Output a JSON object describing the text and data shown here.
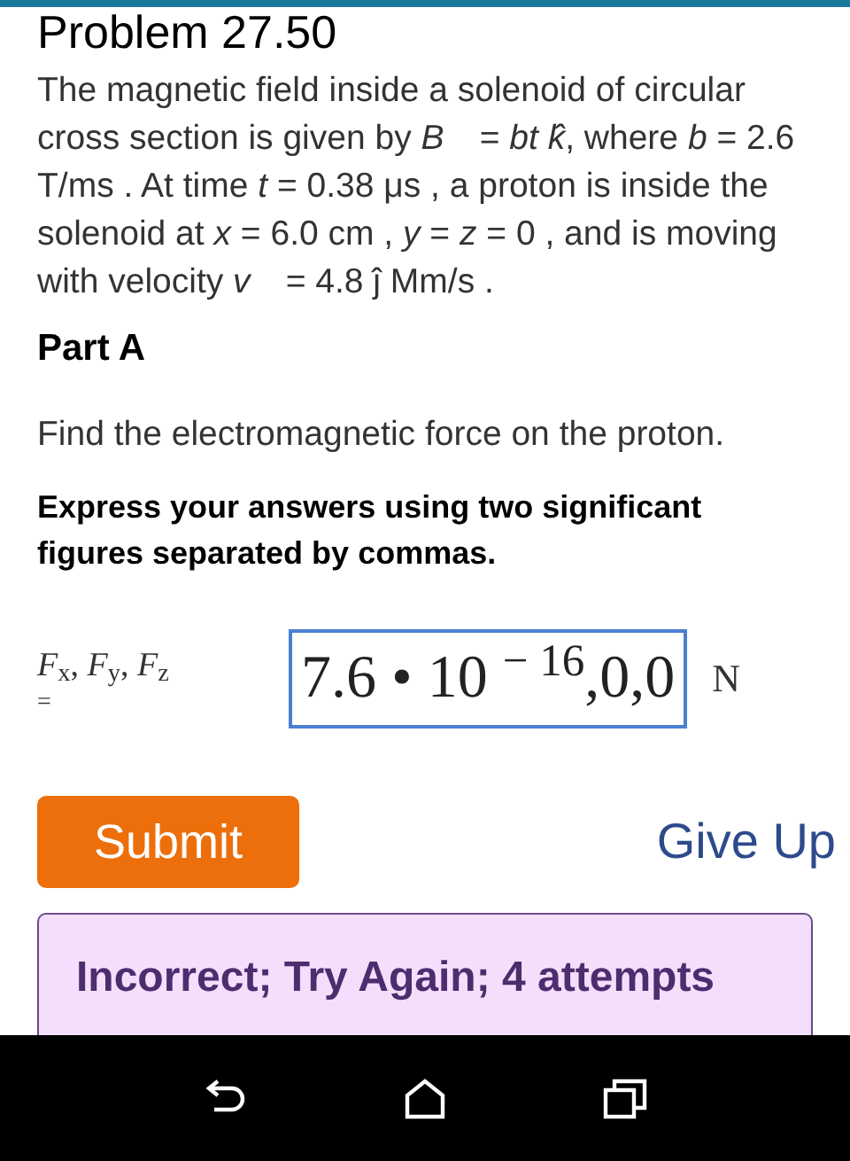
{
  "problem_title": "Problem 27.50",
  "statement": "The magnetic field inside a solenoid of circular cross section is given by *B⃗* = *bt* *k̂*, where *b* = 2.6 T/ms . At time *t* = 0.38 μs , a proton is inside the solenoid at *x* = 6.0 cm , *y* = *z* = 0 , and is moving with velocity *v⃗* = 4.8 ĵ Mm/s .",
  "part": {
    "title": "Part A",
    "question": "Find the electromagnetic force on the proton.",
    "instruction": "Express your answers using two significant figures separated by commas."
  },
  "answer": {
    "label": "*F*$_{x}$, *F*$_{y}$, *F*$_{z}$",
    "equals": "=",
    "value": "7.6 • 10 $^{− 16}$,0,0",
    "unit": "N"
  },
  "buttons": {
    "submit": "Submit",
    "give_up": "Give Up"
  },
  "feedback": {
    "text": "Incorrect; Try Again; 4 attempts"
  }
}
